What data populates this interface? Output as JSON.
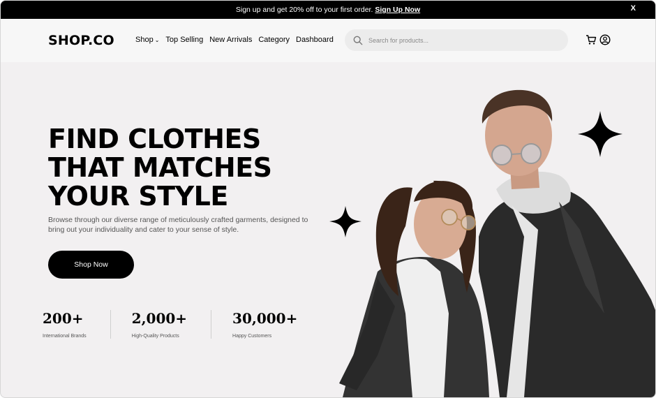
{
  "promo": {
    "text": "Sign up and get 20% off to your first order.",
    "link": "Sign Up Now",
    "close": "X"
  },
  "header": {
    "logo": "SHOP.CO",
    "nav": [
      "Shop",
      "Top Selling",
      "New Arrivals",
      "Category",
      "Dashboard"
    ],
    "search_placeholder": "Search for products...",
    "icons": [
      "cart-icon",
      "user-icon"
    ]
  },
  "hero": {
    "title_lines": [
      "FIND CLOTHES",
      "THAT MATCHES",
      "YOUR STYLE"
    ],
    "subtitle": "Browse through our diverse range of meticulously crafted garments, designed to bring out your individuality and cater to your sense of style.",
    "cta": "Shop Now",
    "stats": [
      {
        "value": "200+",
        "label": "International Brands"
      },
      {
        "value": "2,000+",
        "label": "High-Quality Products"
      },
      {
        "value": "30,000+",
        "label": "Happy Customers"
      }
    ]
  },
  "colors": {
    "bar": "#000000",
    "hero_bg": "#f2f0f1",
    "header_bg": "#f7f7f7",
    "search_bg": "#ececec"
  }
}
